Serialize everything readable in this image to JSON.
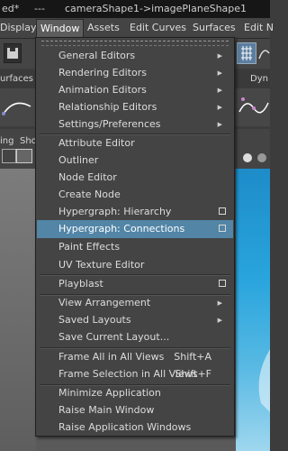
{
  "title_bar": {
    "left_fragment": "ed*",
    "separator": "---",
    "window_title": "cameraShape1->imagePlaneShape1"
  },
  "menubar": {
    "items": [
      {
        "label": "Display"
      },
      {
        "label": "Window"
      },
      {
        "label": "Assets"
      },
      {
        "label": "Edit Curves"
      },
      {
        "label": "Surfaces"
      },
      {
        "label": "Edit N"
      }
    ]
  },
  "background": {
    "shelf_tab_left": "urfaces",
    "shelf_tab_right": "Dyn",
    "panel_menu_left_1": "ing",
    "panel_menu_left_2": "Sho",
    "viewport_sky_color": "#2aa5dd"
  },
  "window_menu": {
    "items": [
      {
        "label": "General Editors",
        "submenu": true
      },
      {
        "label": "Rendering Editors",
        "submenu": true
      },
      {
        "label": "Animation Editors",
        "submenu": true
      },
      {
        "label": "Relationship Editors",
        "submenu": true
      },
      {
        "label": "Settings/Preferences",
        "submenu": true
      },
      {
        "label": "Attribute Editor"
      },
      {
        "label": "Outliner"
      },
      {
        "label": "Node Editor"
      },
      {
        "label": "Create Node"
      },
      {
        "label": "Hypergraph: Hierarchy",
        "option_box": true
      },
      {
        "label": "Hypergraph: Connections",
        "option_box": true,
        "highlighted": true
      },
      {
        "label": "Paint Effects"
      },
      {
        "label": "UV Texture Editor"
      },
      {
        "label": "Playblast",
        "option_box": true
      },
      {
        "label": "View Arrangement",
        "submenu": true
      },
      {
        "label": "Saved Layouts",
        "submenu": true
      },
      {
        "label": "Save Current Layout..."
      },
      {
        "label": "Frame All in All Views",
        "shortcut": "Shift+A"
      },
      {
        "label": "Frame Selection in All Views",
        "shortcut": "Shift+F"
      },
      {
        "label": "Minimize Application"
      },
      {
        "label": "Raise Main Window"
      },
      {
        "label": "Raise Application Windows"
      }
    ]
  },
  "colors": {
    "menu_bg": "#444444",
    "highlight": "#5285a6",
    "titlebar": "#161616"
  }
}
